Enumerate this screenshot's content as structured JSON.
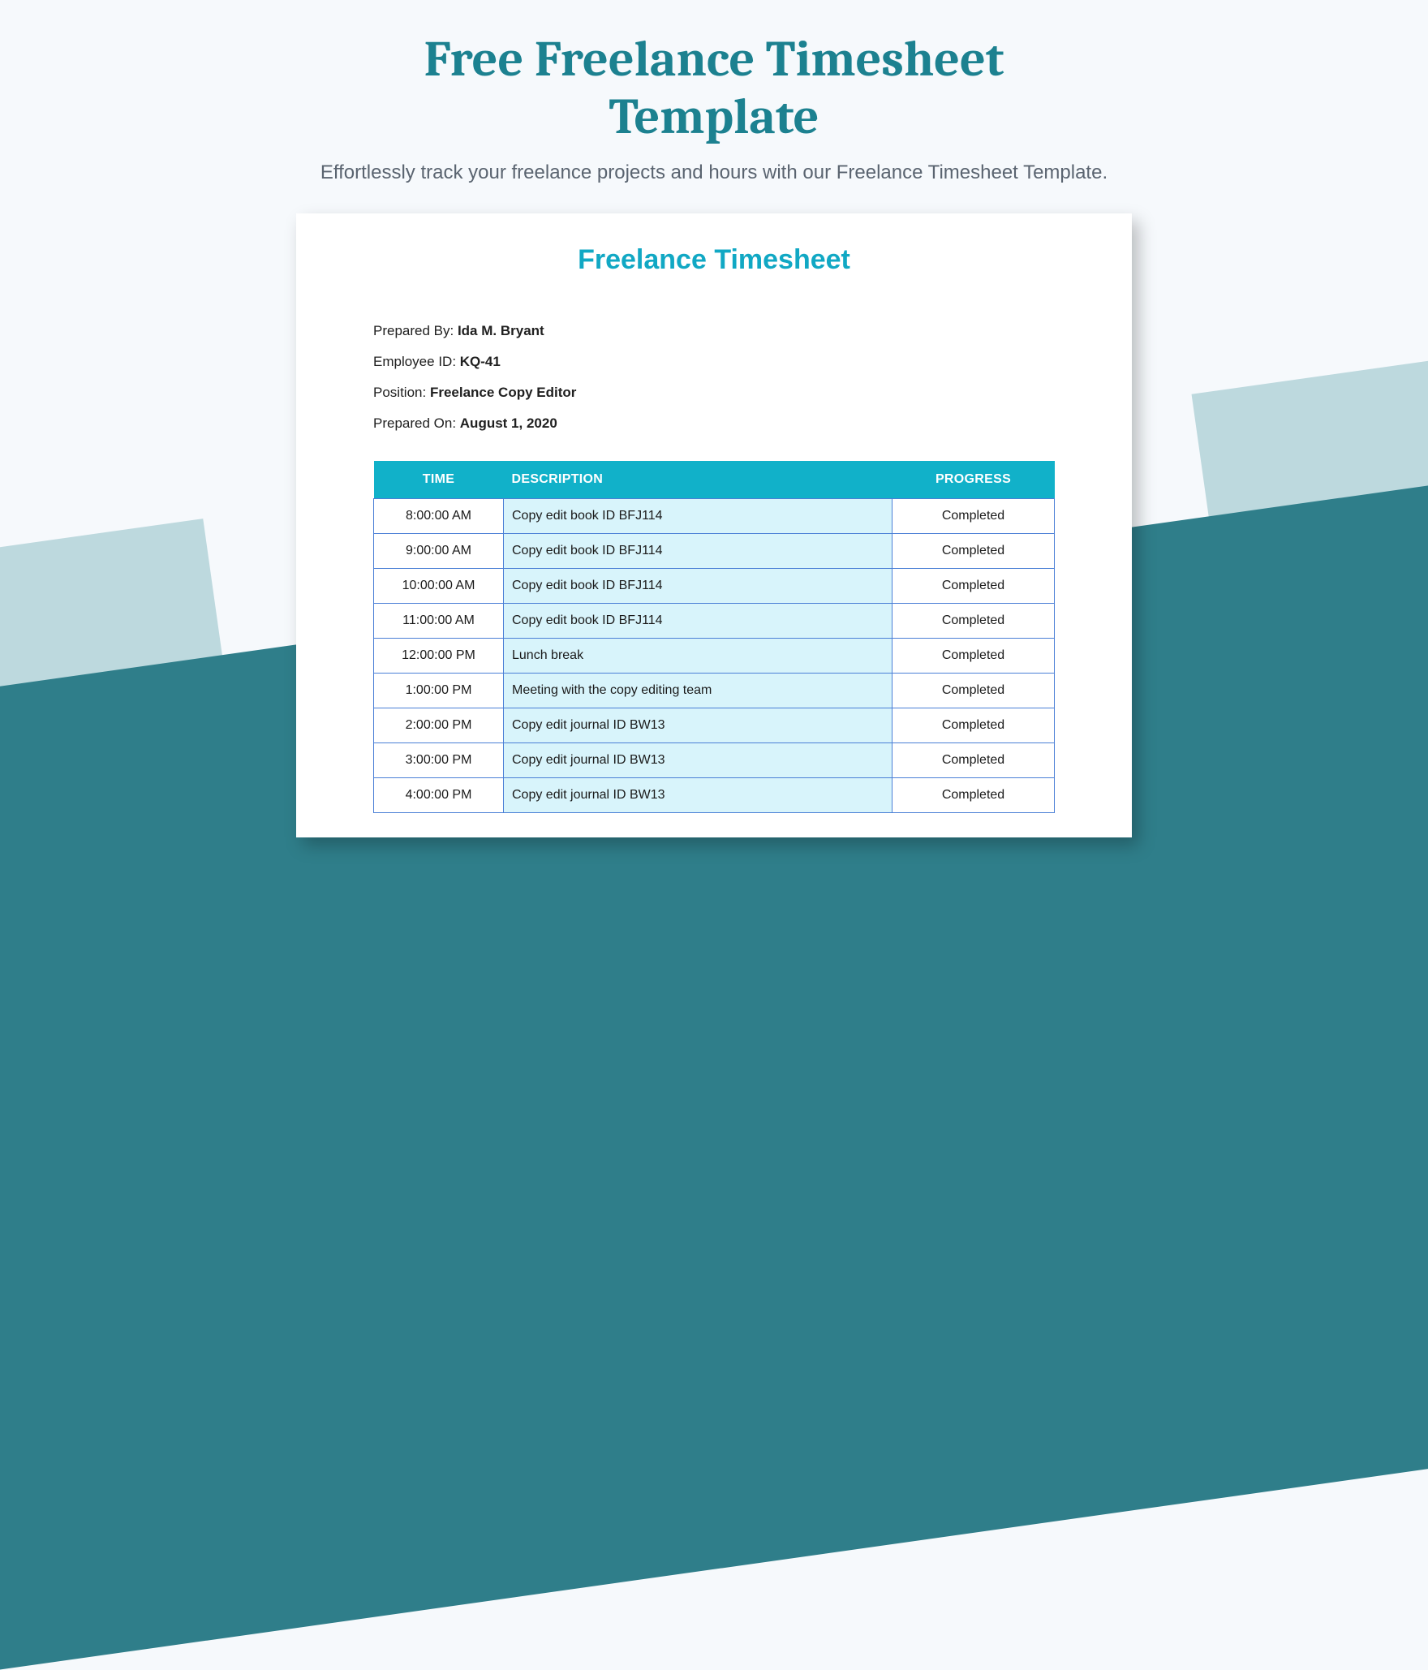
{
  "page": {
    "title": "Free Freelance Timesheet Template",
    "subtitle": "Effortlessly track your freelance projects and hours with our Freelance Timesheet Template."
  },
  "sheet": {
    "title": "Freelance Timesheet",
    "meta": {
      "preparedByLabel": "Prepared By: ",
      "preparedBy": "Ida M. Bryant",
      "employeeIdLabel": "Employee ID: ",
      "employeeId": "KQ-41",
      "positionLabel": "Position: ",
      "position": "Freelance Copy Editor",
      "preparedOnLabel": "Prepared On: ",
      "preparedOn": "August 1, 2020"
    },
    "columns": {
      "time": "TIME",
      "description": "DESCRIPTION",
      "progress": "PROGRESS"
    },
    "rows": [
      {
        "time": "8:00:00 AM",
        "description": "Copy edit book ID BFJ114",
        "progress": "Completed"
      },
      {
        "time": "9:00:00 AM",
        "description": "Copy edit book ID BFJ114",
        "progress": "Completed"
      },
      {
        "time": "10:00:00 AM",
        "description": "Copy edit book ID BFJ114",
        "progress": "Completed"
      },
      {
        "time": "11:00:00 AM",
        "description": "Copy edit book ID BFJ114",
        "progress": "Completed"
      },
      {
        "time": "12:00:00 PM",
        "description": "Lunch break",
        "progress": "Completed"
      },
      {
        "time": "1:00:00 PM",
        "description": "Meeting with the copy editing team",
        "progress": "Completed"
      },
      {
        "time": "2:00:00 PM",
        "description": "Copy edit journal ID BW13",
        "progress": "Completed"
      },
      {
        "time": "3:00:00 PM",
        "description": "Copy edit journal ID BW13",
        "progress": "Completed"
      },
      {
        "time": "4:00:00 PM",
        "description": "Copy edit journal ID BW13",
        "progress": "Completed"
      }
    ]
  }
}
